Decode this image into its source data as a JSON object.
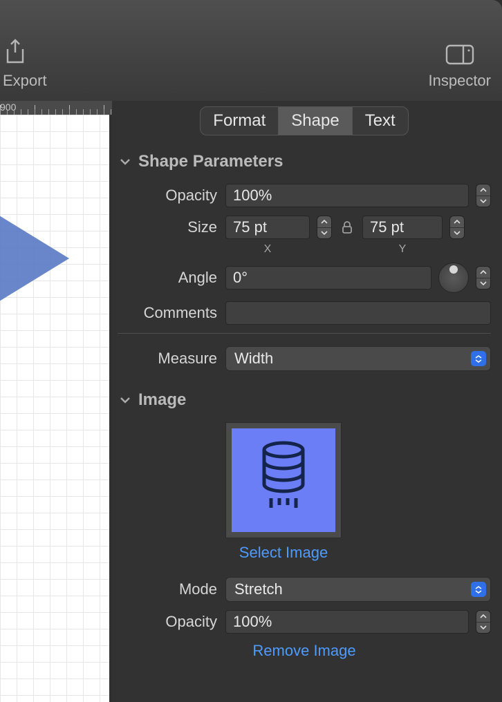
{
  "toolbar": {
    "export_label": "Export",
    "inspector_label": "Inspector"
  },
  "ruler": {
    "tick": "900"
  },
  "tabs": {
    "format": "Format",
    "shape": "Shape",
    "text": "Text"
  },
  "shape_params": {
    "title": "Shape Parameters",
    "opacity_label": "Opacity",
    "opacity_value": "100%",
    "size_label": "Size",
    "size_x_value": "75 pt",
    "size_y_value": "75 pt",
    "axis_x": "X",
    "axis_y": "Y",
    "angle_label": "Angle",
    "angle_value": "0°",
    "comments_label": "Comments",
    "comments_value": "",
    "measure_label": "Measure",
    "measure_value": "Width"
  },
  "image_section": {
    "title": "Image",
    "select_image": "Select Image",
    "mode_label": "Mode",
    "mode_value": "Stretch",
    "opacity_label": "Opacity",
    "opacity_value": "100%",
    "remove_image": "Remove Image"
  }
}
